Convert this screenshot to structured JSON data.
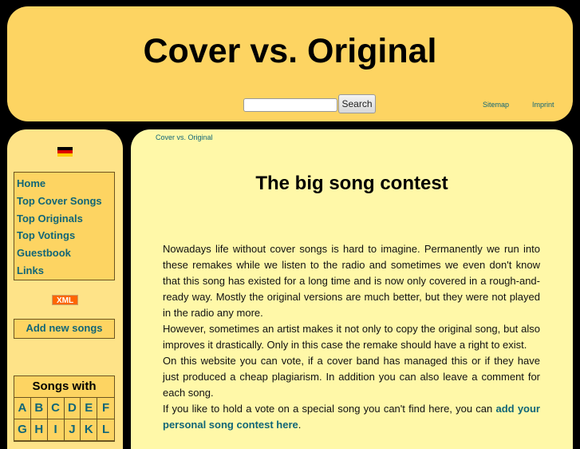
{
  "header": {
    "title": "Cover vs. Original",
    "search_value": "",
    "search_button": "Search",
    "links": [
      "Sitemap",
      "Imprint"
    ]
  },
  "sidebar": {
    "flag": "german-flag-icon",
    "nav": [
      "Home",
      "Top Cover Songs",
      "Top Originals",
      "Top Votings",
      "Guestbook",
      "Links"
    ],
    "xml_badge": "XML",
    "add_new": "Add new songs",
    "songs_with": "Songs with",
    "letters": [
      "A",
      "B",
      "C",
      "D",
      "E",
      "F",
      "G",
      "H",
      "I",
      "J",
      "K",
      "L"
    ]
  },
  "main": {
    "breadcrumb": "Cover vs. Original",
    "heading": "The big song contest",
    "paragraphs": [
      "Nowadays life without cover songs is hard to imagine. Permanently we run into these remakes while we listen to the radio and sometimes we even don't know that this song has existed for a long time and is now only covered in a rough-and-ready way. Mostly the original versions are much better, but they were not played in the radio any more.",
      "However, sometimes an artist makes it not only to copy the original song, but also improves it drastically. Only in this case the remake should have a right to exist.",
      "On this website you can vote, if a cover band has managed this or if they have just produced a cheap plagiarism. In addition you can also leave a comment for each song."
    ],
    "last_text": "If you like to hold a vote on a special song you can't find here, you can ",
    "last_link": "add your personal song contest here",
    "last_end": "."
  },
  "colors": {
    "header": "#fdd462",
    "sidebar": "#fee388",
    "main": "#fff8a8",
    "link": "#116677"
  }
}
